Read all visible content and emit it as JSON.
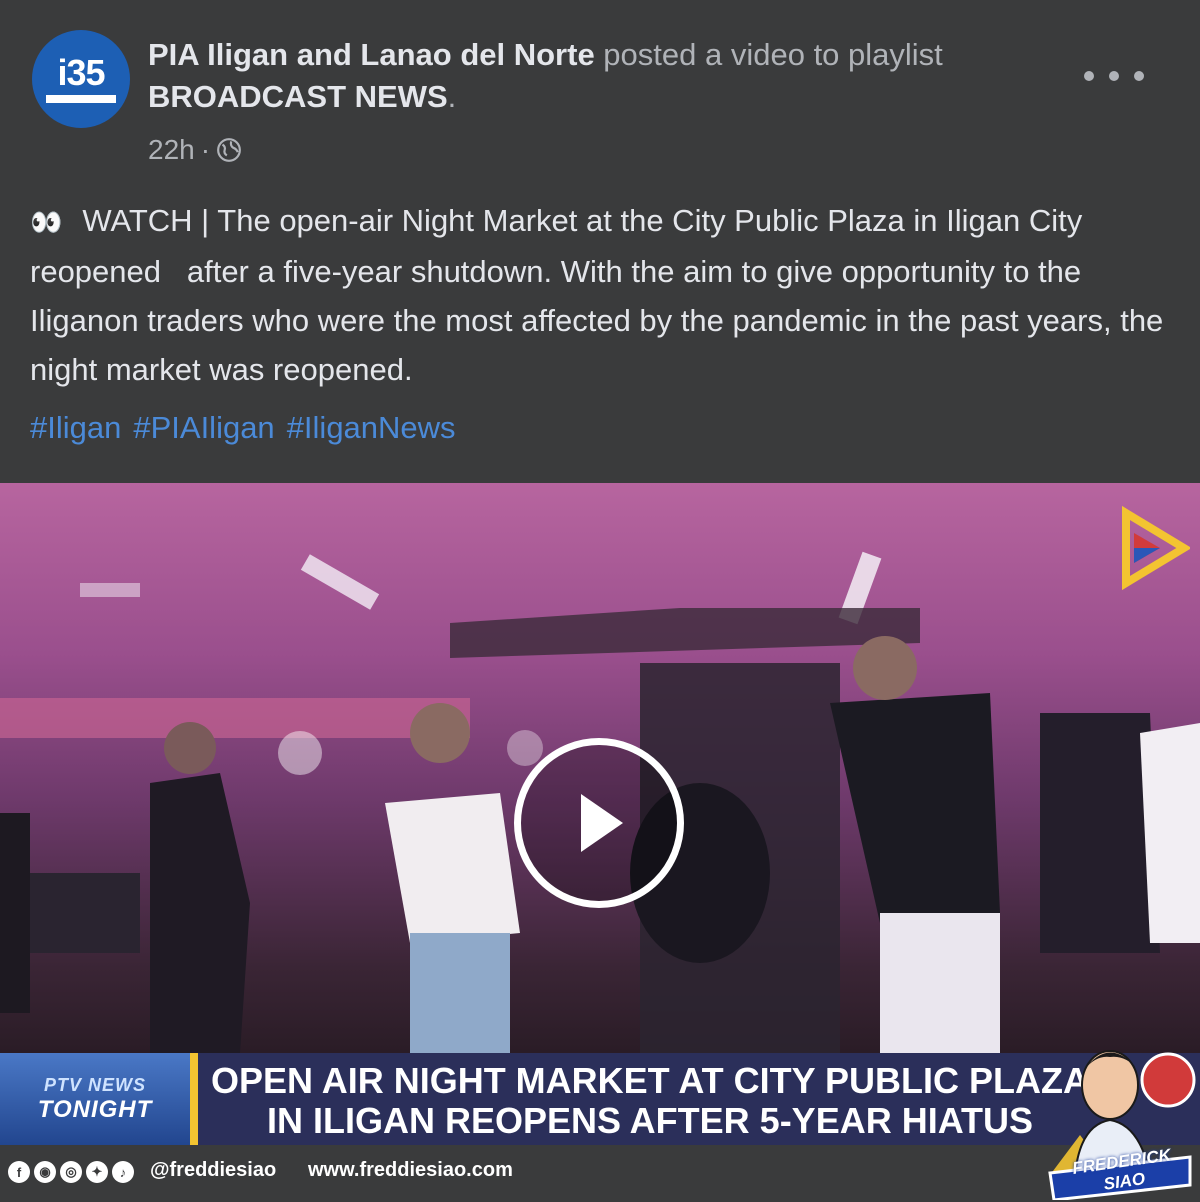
{
  "post": {
    "avatar_text": "i35",
    "page_name": "PIA Iligan and Lanao del Norte",
    "posted_text": " posted a video to playlist ",
    "playlist_name": "BROADCAST NEWS",
    "playlist_period": ".",
    "time": "22h",
    "separator": "·",
    "privacy_icon": "globe-icon",
    "more_icon": "more-horizontal-icon",
    "body_text": "WATCH | The open-air Night Market at the City Public Plaza in Iligan City  reopened   after a five-year shutdown. With the aim to give opportunity to the  Iliganon traders who were the most affected by the pandemic in the past years, the  night market was reopened.",
    "hashtags": [
      "#Iligan",
      "#PIAIligan",
      "#IliganNews"
    ]
  },
  "video": {
    "play_icon": "play-icon",
    "channel_logo": "ptv-logo",
    "lower_third": {
      "badge_line1": "PTV NEWS",
      "badge_line2": "TONIGHT",
      "headline": "OPEN AIR NIGHT MARKET AT CITY PUBLIC PLAZA IN ILIGAN REOPENS AFTER 5-YEAR HIATUS"
    }
  },
  "footer": {
    "handle": "@freddiesiao",
    "website": "www.freddiesiao.com",
    "social_icons": [
      "facebook-icon",
      "messenger-icon",
      "instagram-icon",
      "twitter-icon",
      "tiktok-icon"
    ],
    "signature_name": "FREDERICK SIAO"
  },
  "colors": {
    "background": "#3a3b3c",
    "hashtag": "#4b8ad8",
    "lower_third": "#2b2f5a",
    "accent": "#f3c431"
  }
}
